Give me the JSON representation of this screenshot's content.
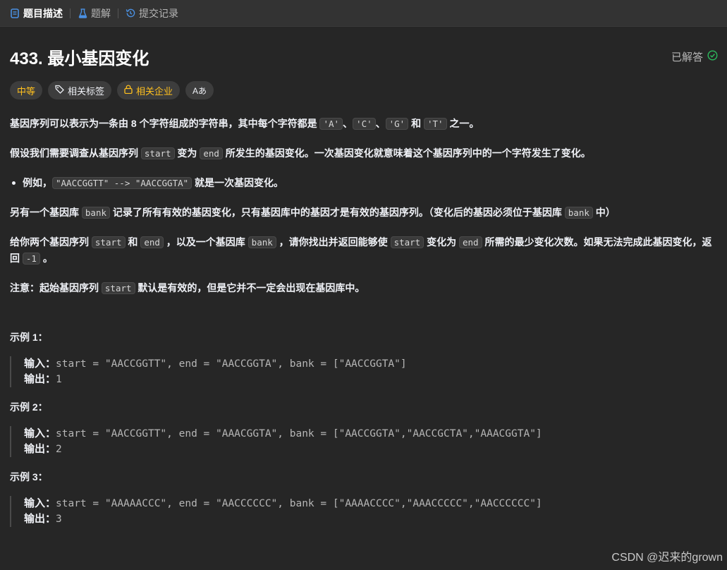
{
  "tabs": [
    {
      "label": "题目描述",
      "icon": "document-icon"
    },
    {
      "label": "题解",
      "icon": "flask-icon"
    },
    {
      "label": "提交记录",
      "icon": "history-icon"
    }
  ],
  "problem": {
    "title": "433. 最小基因变化",
    "solved_label": "已解答",
    "tags": {
      "difficulty": "中等",
      "related": "相关标签",
      "company": "相关企业",
      "translate": "Aあ"
    }
  },
  "desc": {
    "p1_a": "基因序列可以表示为一条由 8 个字符组成的字符串，其中每个字符都是 ",
    "c_A": "'A'",
    "sep1": "、",
    "c_C": "'C'",
    "sep2": "、",
    "c_G": "'G'",
    "and1": " 和 ",
    "c_T": "'T'",
    "p1_end": " 之一。",
    "p2_a": "假设我们需要调查从基因序列 ",
    "start": "start",
    "p2_b": " 变为 ",
    "end": "end",
    "p2_c": " 所发生的基因变化。一次基因变化就意味着这个基因序列中的一个字符发生了变化。",
    "b1_a": "例如，",
    "b1_code": "\"AACCGGTT\" --> \"AACCGGTA\"",
    "b1_b": " 就是一次基因变化。",
    "p3_a": "另有一个基因库 ",
    "bank": "bank",
    "p3_b": " 记录了所有有效的基因变化，只有基因库中的基因才是有效的基因序列。（变化后的基因必须位于基因库 ",
    "p3_c": " 中）",
    "p4_a": "给你两个基因序列 ",
    "p4_b": " 和 ",
    "p4_c": " ，以及一个基因库 ",
    "p4_d": " ，请你找出并返回能够使 ",
    "p4_e": " 变化为 ",
    "p4_f": " 所需的最少变化次数。如果无法完成此基因变化，返回 ",
    "neg1": "-1",
    "p4_g": " 。",
    "p5_a": "注意：起始基因序列 ",
    "p5_b": " 默认是有效的，但是它并不一定会出现在基因库中。"
  },
  "examples": [
    {
      "title": "示例 1：",
      "input_label": "输入：",
      "input": "start = \"AACCGGTT\", end = \"AACCGGTA\", bank = [\"AACCGGTA\"]",
      "output_label": "输出：",
      "output": "1"
    },
    {
      "title": "示例 2：",
      "input_label": "输入：",
      "input": "start = \"AACCGGTT\", end = \"AAACGGTA\", bank = [\"AACCGGTA\",\"AACCGCTA\",\"AAACGGTA\"]",
      "output_label": "输出：",
      "output": "2"
    },
    {
      "title": "示例 3：",
      "input_label": "输入：",
      "input": "start = \"AAAAACCC\", end = \"AACCCCCC\", bank = [\"AAAACCCC\",\"AAACCCCC\",\"AACCCCCC\"]",
      "output_label": "输出：",
      "output": "3"
    }
  ],
  "watermark": "CSDN @迟来的grown",
  "colors": {
    "accent": "#ffc01e",
    "check": "#2cbb5d",
    "tab_active": "#4a90e2"
  }
}
